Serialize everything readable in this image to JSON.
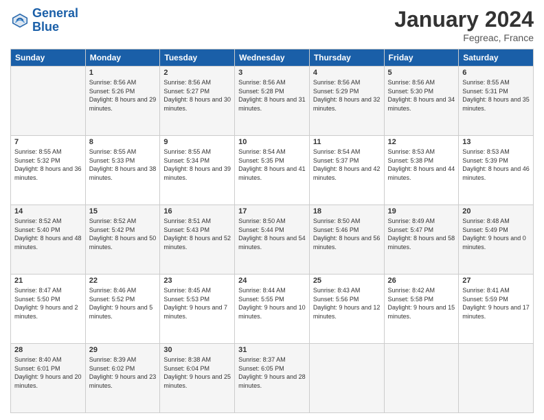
{
  "logo": {
    "line1": "General",
    "line2": "Blue"
  },
  "header": {
    "month": "January 2024",
    "location": "Fegreac, France"
  },
  "weekdays": [
    "Sunday",
    "Monday",
    "Tuesday",
    "Wednesday",
    "Thursday",
    "Friday",
    "Saturday"
  ],
  "weeks": [
    [
      {
        "day": "",
        "sunrise": "",
        "sunset": "",
        "daylight": ""
      },
      {
        "day": "1",
        "sunrise": "Sunrise: 8:56 AM",
        "sunset": "Sunset: 5:26 PM",
        "daylight": "Daylight: 8 hours and 29 minutes."
      },
      {
        "day": "2",
        "sunrise": "Sunrise: 8:56 AM",
        "sunset": "Sunset: 5:27 PM",
        "daylight": "Daylight: 8 hours and 30 minutes."
      },
      {
        "day": "3",
        "sunrise": "Sunrise: 8:56 AM",
        "sunset": "Sunset: 5:28 PM",
        "daylight": "Daylight: 8 hours and 31 minutes."
      },
      {
        "day": "4",
        "sunrise": "Sunrise: 8:56 AM",
        "sunset": "Sunset: 5:29 PM",
        "daylight": "Daylight: 8 hours and 32 minutes."
      },
      {
        "day": "5",
        "sunrise": "Sunrise: 8:56 AM",
        "sunset": "Sunset: 5:30 PM",
        "daylight": "Daylight: 8 hours and 34 minutes."
      },
      {
        "day": "6",
        "sunrise": "Sunrise: 8:55 AM",
        "sunset": "Sunset: 5:31 PM",
        "daylight": "Daylight: 8 hours and 35 minutes."
      }
    ],
    [
      {
        "day": "7",
        "sunrise": "Sunrise: 8:55 AM",
        "sunset": "Sunset: 5:32 PM",
        "daylight": "Daylight: 8 hours and 36 minutes."
      },
      {
        "day": "8",
        "sunrise": "Sunrise: 8:55 AM",
        "sunset": "Sunset: 5:33 PM",
        "daylight": "Daylight: 8 hours and 38 minutes."
      },
      {
        "day": "9",
        "sunrise": "Sunrise: 8:55 AM",
        "sunset": "Sunset: 5:34 PM",
        "daylight": "Daylight: 8 hours and 39 minutes."
      },
      {
        "day": "10",
        "sunrise": "Sunrise: 8:54 AM",
        "sunset": "Sunset: 5:35 PM",
        "daylight": "Daylight: 8 hours and 41 minutes."
      },
      {
        "day": "11",
        "sunrise": "Sunrise: 8:54 AM",
        "sunset": "Sunset: 5:37 PM",
        "daylight": "Daylight: 8 hours and 42 minutes."
      },
      {
        "day": "12",
        "sunrise": "Sunrise: 8:53 AM",
        "sunset": "Sunset: 5:38 PM",
        "daylight": "Daylight: 8 hours and 44 minutes."
      },
      {
        "day": "13",
        "sunrise": "Sunrise: 8:53 AM",
        "sunset": "Sunset: 5:39 PM",
        "daylight": "Daylight: 8 hours and 46 minutes."
      }
    ],
    [
      {
        "day": "14",
        "sunrise": "Sunrise: 8:52 AM",
        "sunset": "Sunset: 5:40 PM",
        "daylight": "Daylight: 8 hours and 48 minutes."
      },
      {
        "day": "15",
        "sunrise": "Sunrise: 8:52 AM",
        "sunset": "Sunset: 5:42 PM",
        "daylight": "Daylight: 8 hours and 50 minutes."
      },
      {
        "day": "16",
        "sunrise": "Sunrise: 8:51 AM",
        "sunset": "Sunset: 5:43 PM",
        "daylight": "Daylight: 8 hours and 52 minutes."
      },
      {
        "day": "17",
        "sunrise": "Sunrise: 8:50 AM",
        "sunset": "Sunset: 5:44 PM",
        "daylight": "Daylight: 8 hours and 54 minutes."
      },
      {
        "day": "18",
        "sunrise": "Sunrise: 8:50 AM",
        "sunset": "Sunset: 5:46 PM",
        "daylight": "Daylight: 8 hours and 56 minutes."
      },
      {
        "day": "19",
        "sunrise": "Sunrise: 8:49 AM",
        "sunset": "Sunset: 5:47 PM",
        "daylight": "Daylight: 8 hours and 58 minutes."
      },
      {
        "day": "20",
        "sunrise": "Sunrise: 8:48 AM",
        "sunset": "Sunset: 5:49 PM",
        "daylight": "Daylight: 9 hours and 0 minutes."
      }
    ],
    [
      {
        "day": "21",
        "sunrise": "Sunrise: 8:47 AM",
        "sunset": "Sunset: 5:50 PM",
        "daylight": "Daylight: 9 hours and 2 minutes."
      },
      {
        "day": "22",
        "sunrise": "Sunrise: 8:46 AM",
        "sunset": "Sunset: 5:52 PM",
        "daylight": "Daylight: 9 hours and 5 minutes."
      },
      {
        "day": "23",
        "sunrise": "Sunrise: 8:45 AM",
        "sunset": "Sunset: 5:53 PM",
        "daylight": "Daylight: 9 hours and 7 minutes."
      },
      {
        "day": "24",
        "sunrise": "Sunrise: 8:44 AM",
        "sunset": "Sunset: 5:55 PM",
        "daylight": "Daylight: 9 hours and 10 minutes."
      },
      {
        "day": "25",
        "sunrise": "Sunrise: 8:43 AM",
        "sunset": "Sunset: 5:56 PM",
        "daylight": "Daylight: 9 hours and 12 minutes."
      },
      {
        "day": "26",
        "sunrise": "Sunrise: 8:42 AM",
        "sunset": "Sunset: 5:58 PM",
        "daylight": "Daylight: 9 hours and 15 minutes."
      },
      {
        "day": "27",
        "sunrise": "Sunrise: 8:41 AM",
        "sunset": "Sunset: 5:59 PM",
        "daylight": "Daylight: 9 hours and 17 minutes."
      }
    ],
    [
      {
        "day": "28",
        "sunrise": "Sunrise: 8:40 AM",
        "sunset": "Sunset: 6:01 PM",
        "daylight": "Daylight: 9 hours and 20 minutes."
      },
      {
        "day": "29",
        "sunrise": "Sunrise: 8:39 AM",
        "sunset": "Sunset: 6:02 PM",
        "daylight": "Daylight: 9 hours and 23 minutes."
      },
      {
        "day": "30",
        "sunrise": "Sunrise: 8:38 AM",
        "sunset": "Sunset: 6:04 PM",
        "daylight": "Daylight: 9 hours and 25 minutes."
      },
      {
        "day": "31",
        "sunrise": "Sunrise: 8:37 AM",
        "sunset": "Sunset: 6:05 PM",
        "daylight": "Daylight: 9 hours and 28 minutes."
      },
      {
        "day": "",
        "sunrise": "",
        "sunset": "",
        "daylight": ""
      },
      {
        "day": "",
        "sunrise": "",
        "sunset": "",
        "daylight": ""
      },
      {
        "day": "",
        "sunrise": "",
        "sunset": "",
        "daylight": ""
      }
    ]
  ]
}
